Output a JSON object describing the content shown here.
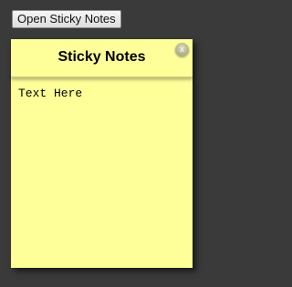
{
  "toolbar": {
    "open_button_label": "Open Sticky Notes"
  },
  "note": {
    "title": "Sticky Notes",
    "close_label": "x",
    "body_text": "Text Here",
    "background_color": "#ffff99"
  }
}
